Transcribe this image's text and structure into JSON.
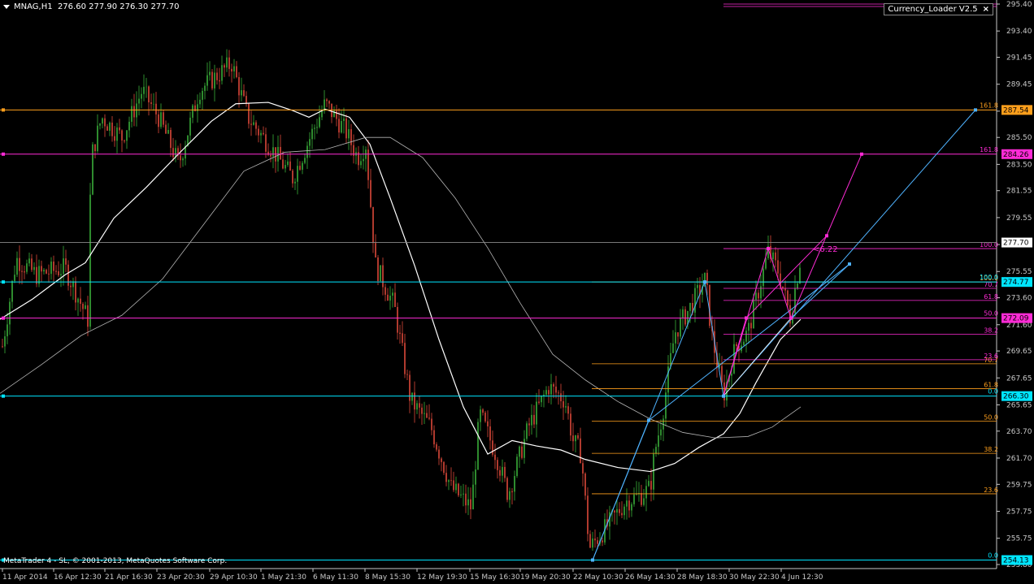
{
  "header": {
    "symbol_line": "MNAG,H1  276.60 277.90 276.30 277.70"
  },
  "indicator": {
    "name": "Currency_Loader V2.5",
    "close_label": "×"
  },
  "copyright": "MetaTrader 4 - SL, © 2001-2013, MetaQuotes Software Corp.",
  "colors": {
    "background": "#000000",
    "bull": "#2e8b2e",
    "bear": "#b03a2e",
    "fast_ma": "#ffffff",
    "slow_ma": "#b4b4b4",
    "orange": "#ff9f1c",
    "magenta": "#ff2bd6",
    "cyan": "#00e5ff",
    "blue": "#4fb3ff",
    "axis": "#c8c8c8"
  },
  "price_axis": {
    "ticks": [
      "295.40",
      "293.40",
      "291.45",
      "289.45",
      "287.45",
      "285.50",
      "283.50",
      "281.55",
      "279.55",
      "277.55",
      "275.55",
      "273.60",
      "271.60",
      "269.65",
      "267.65",
      "265.65",
      "263.70",
      "261.70",
      "259.75",
      "257.75",
      "255.75",
      "253.80"
    ],
    "current_price": "277.70"
  },
  "time_axis": {
    "labels": [
      "11 Apr 2014",
      "16 Apr 12:30",
      "21 Apr 16:30",
      "23 Apr 20:30",
      "29 Apr 10:30",
      "1 May 21:30",
      "6 May 11:30",
      "8 May 15:30",
      "12 May 19:30",
      "15 May 16:30",
      "19 May 20:30",
      "22 May 10:30",
      "26 May 14:30",
      "28 May 18:30",
      "30 May 22:30",
      "4 Jun 12:30"
    ]
  },
  "horizontal_levels": [
    {
      "price": 287.54,
      "label": "287.54",
      "color": "orange",
      "tag": "161.8"
    },
    {
      "price": 284.26,
      "label": "284.26",
      "color": "magenta",
      "tag": "161.8"
    },
    {
      "price": 274.77,
      "label": "274.77",
      "color": "cyan",
      "tag": "100.0"
    },
    {
      "price": 272.09,
      "label": "272.09",
      "color": "magenta",
      "tag": "50.0"
    },
    {
      "price": 266.3,
      "label": "266.30",
      "color": "cyan",
      "tag": "0.0"
    },
    {
      "price": 254.13,
      "label": "254.13",
      "color": "cyan",
      "tag": "0.0"
    }
  ],
  "fib_orange": [
    {
      "tag": "161.8",
      "price": 287.54
    },
    {
      "tag": "100.0",
      "price": 274.77
    },
    {
      "tag": "70.7",
      "price": 268.7
    },
    {
      "tag": "61.8",
      "price": 266.85
    },
    {
      "tag": "50.0",
      "price": 264.45
    },
    {
      "tag": "38.2",
      "price": 262.05
    },
    {
      "tag": "23.6",
      "price": 259.05
    },
    {
      "tag": "0.0",
      "price": 254.13
    }
  ],
  "fib_magenta": [
    {
      "tag": "100.0",
      "price": 277.25
    },
    {
      "tag": "70.7",
      "price": 274.3
    },
    {
      "tag": "61.8",
      "price": 273.4
    },
    {
      "tag": "50.0",
      "price": 272.09
    },
    {
      "tag": "38.2",
      "price": 270.9
    },
    {
      "tag": "23.6",
      "price": 269.0
    },
    {
      "tag": "0.0",
      "price": 266.3
    }
  ],
  "annotation": "<6.22"
}
